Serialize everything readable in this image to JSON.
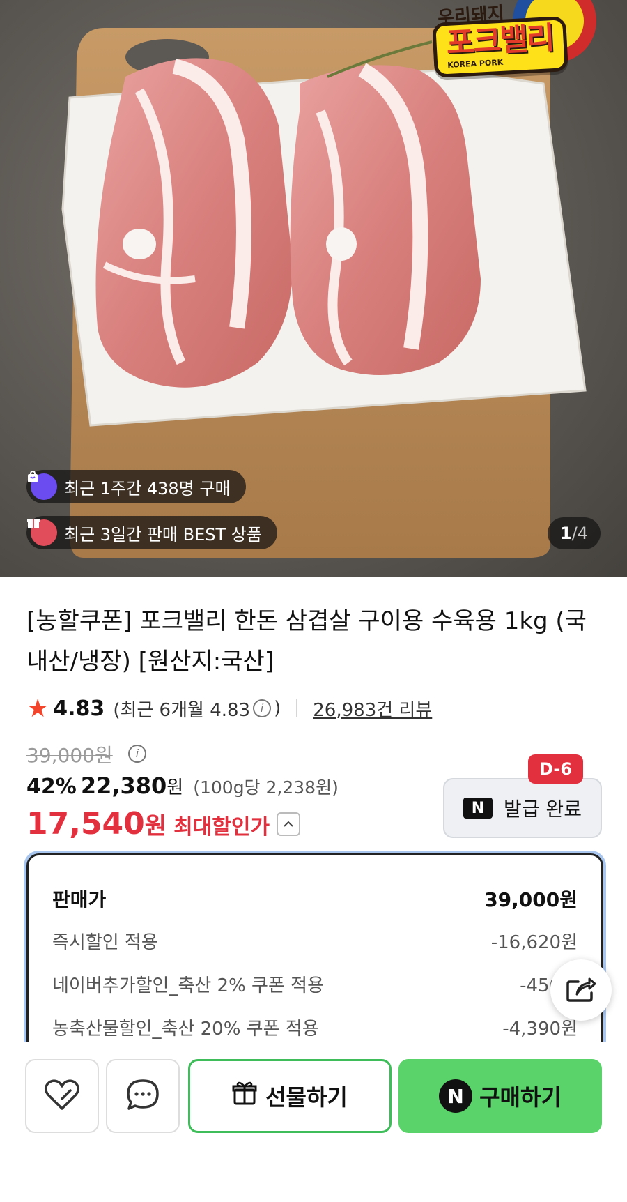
{
  "hero": {
    "brand": {
      "top": "우리돼지",
      "main": "포크밸리",
      "sub": "KOREA PORK"
    },
    "badge_recent_buy": "최근 1주간 438명 구매",
    "badge_best": "최근 3일간 판매 BEST 상품",
    "counter": {
      "current": "1",
      "separator": "/",
      "total": "4"
    }
  },
  "product": {
    "title": "[농할쿠폰] 포크밸리 한돈 삼겹살 구이용 수육용 1kg (국내산/냉장) [원산지:국산]",
    "rating": "4.83",
    "rating_recent": "(최근 6개월 4.83",
    "rating_recent_close": ")",
    "review_count": "26,983건 리뷰"
  },
  "price": {
    "original": "39,000원",
    "discount_pct": "42%",
    "discount_price": "22,380",
    "won": "원",
    "per_100g": "(100g당 2,238원)",
    "max_price": "17,540",
    "max_won": "원",
    "max_label": "최대할인가"
  },
  "coupon": {
    "dday": "D-6",
    "naver_mark": "N",
    "label": "발급 완료"
  },
  "breakdown": {
    "rows": [
      {
        "label": "판매가",
        "value": "39,000원"
      },
      {
        "label": "즉시할인 적용",
        "value": "-16,620원"
      },
      {
        "label": "네이버추가할인_축산 2% 쿠폰 적용",
        "value": "-450원"
      },
      {
        "label": "농축산물할인_축산 20% 쿠폰 적용",
        "value": "-4,390원"
      }
    ]
  },
  "actions": {
    "gift_label": "선물하기",
    "buy_mark": "N",
    "buy_label": "구매하기"
  },
  "colors": {
    "sale_red": "#e2303e",
    "buy_green": "#5ad36a",
    "gift_border": "#3fbd5a",
    "star": "#f2452c"
  }
}
